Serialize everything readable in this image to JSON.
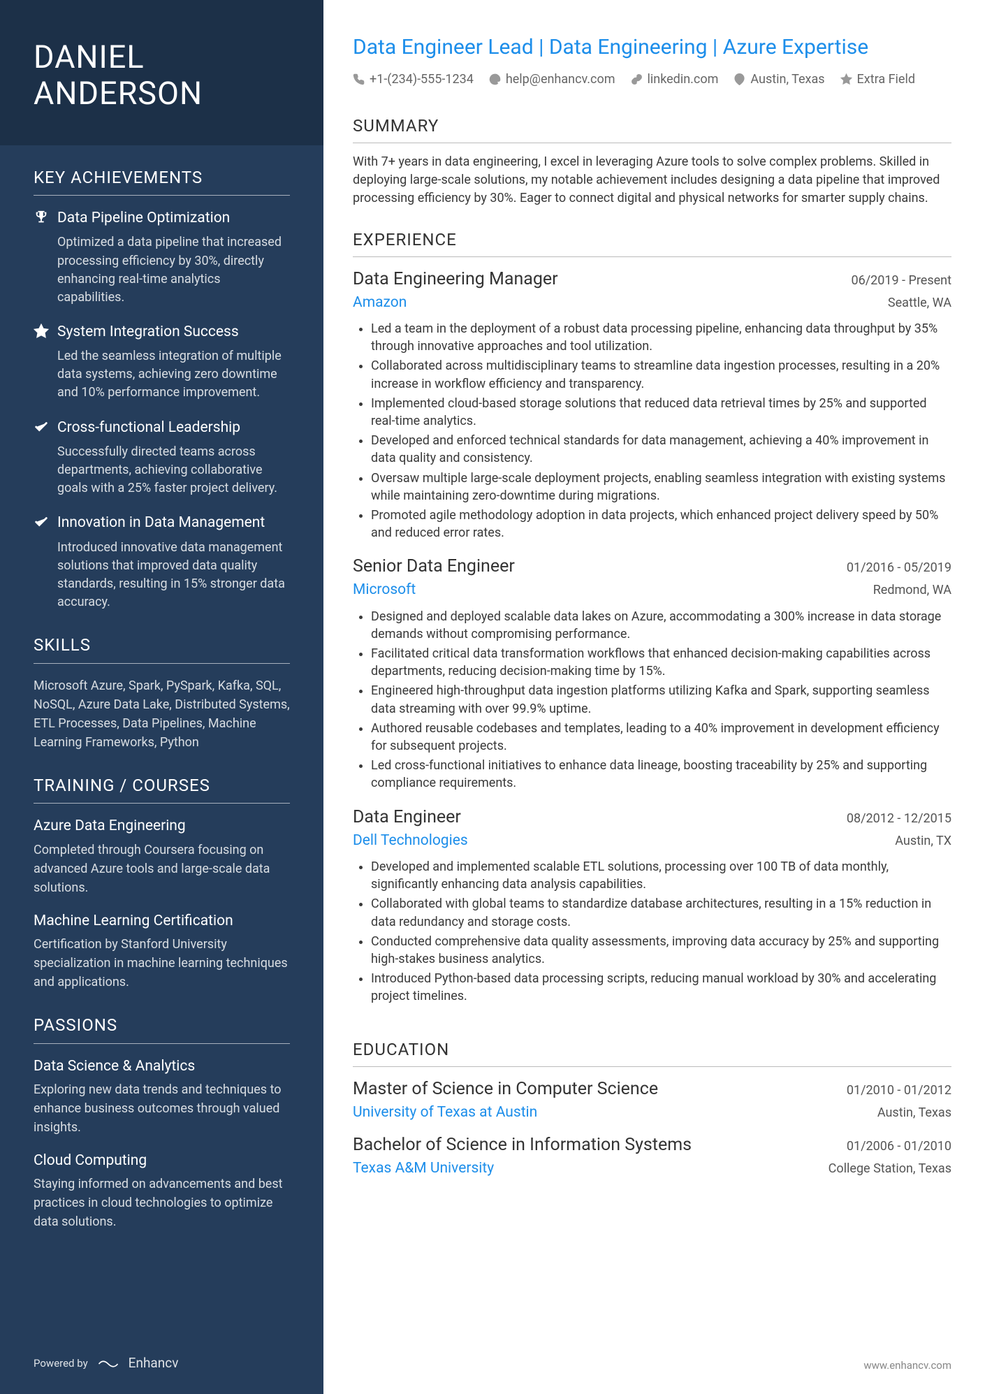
{
  "name": {
    "first": "DANIEL",
    "last": "ANDERSON"
  },
  "sidebar": {
    "achievements_title": "KEY ACHIEVEMENTS",
    "achievements": [
      {
        "icon": "trophy-icon",
        "title": "Data Pipeline Optimization",
        "desc": "Optimized a data pipeline that increased processing efficiency by 30%, directly enhancing real-time analytics capabilities."
      },
      {
        "icon": "star-icon",
        "title": "System Integration Success",
        "desc": "Led the seamless integration of multiple data systems, achieving zero downtime and 10% performance improvement."
      },
      {
        "icon": "check-icon",
        "title": "Cross-functional Leadership",
        "desc": "Successfully directed teams across departments, achieving collaborative goals with a 25% faster project delivery."
      },
      {
        "icon": "check-icon",
        "title": "Innovation in Data Management",
        "desc": "Introduced innovative data management solutions that improved data quality standards, resulting in 15% stronger data accuracy."
      }
    ],
    "skills_title": "SKILLS",
    "skills": "Microsoft Azure, Spark, PySpark, Kafka, SQL, NoSQL, Azure Data Lake, Distributed Systems, ETL Processes, Data Pipelines, Machine Learning Frameworks, Python",
    "courses_title": "TRAINING / COURSES",
    "courses": [
      {
        "title": "Azure Data Engineering",
        "desc": "Completed through Coursera focusing on advanced Azure tools and large-scale data solutions."
      },
      {
        "title": "Machine Learning Certification",
        "desc": "Certification by Stanford University specialization in machine learning techniques and applications."
      }
    ],
    "passions_title": "PASSIONS",
    "passions": [
      {
        "title": "Data Science & Analytics",
        "desc": "Exploring new data trends and techniques to enhance business outcomes through valued insights."
      },
      {
        "title": "Cloud Computing",
        "desc": "Staying informed on advancements and best practices in cloud technologies to optimize data solutions."
      }
    ],
    "powered_by": "Powered by",
    "brand": "Enhancv"
  },
  "main": {
    "headline": "Data Engineer Lead | Data Engineering | Azure Expertise",
    "contacts": {
      "phone": "+1-(234)-555-1234",
      "email": "help@enhancv.com",
      "linkedin": "linkedin.com",
      "location": "Austin, Texas",
      "extra": "Extra Field"
    },
    "summary_title": "SUMMARY",
    "summary": "With 7+ years in data engineering, I excel in leveraging Azure tools to solve complex problems. Skilled in deploying large-scale solutions, my notable achievement includes designing a data pipeline that improved processing efficiency by 30%. Eager to connect digital and physical networks for smarter supply chains.",
    "experience_title": "EXPERIENCE",
    "jobs": [
      {
        "title": "Data Engineering Manager",
        "date": "06/2019 - Present",
        "company": "Amazon",
        "loc": "Seattle, WA",
        "bullets": [
          "Led a team in the deployment of a robust data processing pipeline, enhancing data throughput by 35% through innovative approaches and tool utilization.",
          "Collaborated across multidisciplinary teams to streamline data ingestion processes, resulting in a 20% increase in workflow efficiency and transparency.",
          "Implemented cloud-based storage solutions that reduced data retrieval times by 25% and supported real-time analytics.",
          "Developed and enforced technical standards for data management, achieving a 40% improvement in data quality and consistency.",
          "Oversaw multiple large-scale deployment projects, enabling seamless integration with existing systems while maintaining zero-downtime during migrations.",
          "Promoted agile methodology adoption in data projects, which enhanced project delivery speed by 50% and reduced error rates."
        ]
      },
      {
        "title": "Senior Data Engineer",
        "date": "01/2016 - 05/2019",
        "company": "Microsoft",
        "loc": "Redmond, WA",
        "bullets": [
          "Designed and deployed scalable data lakes on Azure, accommodating a 300% increase in data storage demands without compromising performance.",
          "Facilitated critical data transformation workflows that enhanced decision-making capabilities across departments, reducing decision-making time by 15%.",
          "Engineered high-throughput data ingestion platforms utilizing Kafka and Spark, supporting seamless data streaming with over 99.9% uptime.",
          "Authored reusable codebases and templates, leading to a 40% improvement in development efficiency for subsequent projects.",
          "Led cross-functional initiatives to enhance data lineage, boosting traceability by 25% and supporting compliance requirements."
        ]
      },
      {
        "title": "Data Engineer",
        "date": "08/2012 - 12/2015",
        "company": "Dell Technologies",
        "loc": "Austin, TX",
        "bullets": [
          "Developed and implemented scalable ETL solutions, processing over 100 TB of data monthly, significantly enhancing data analysis capabilities.",
          "Collaborated with global teams to standardize database architectures, resulting in a 15% reduction in data redundancy and storage costs.",
          "Conducted comprehensive data quality assessments, improving data accuracy by 25% and supporting high-stakes business analytics.",
          "Introduced Python-based data processing scripts, reducing manual workload by 30% and accelerating project timelines."
        ]
      }
    ],
    "education_title": "EDUCATION",
    "education": [
      {
        "degree": "Master of Science in Computer Science",
        "date": "01/2010 - 01/2012",
        "school": "University of Texas at Austin",
        "loc": "Austin, Texas"
      },
      {
        "degree": "Bachelor of Science in Information Systems",
        "date": "01/2006 - 01/2010",
        "school": "Texas A&M University",
        "loc": "College Station, Texas"
      }
    ],
    "footer_url": "www.enhancv.com"
  }
}
